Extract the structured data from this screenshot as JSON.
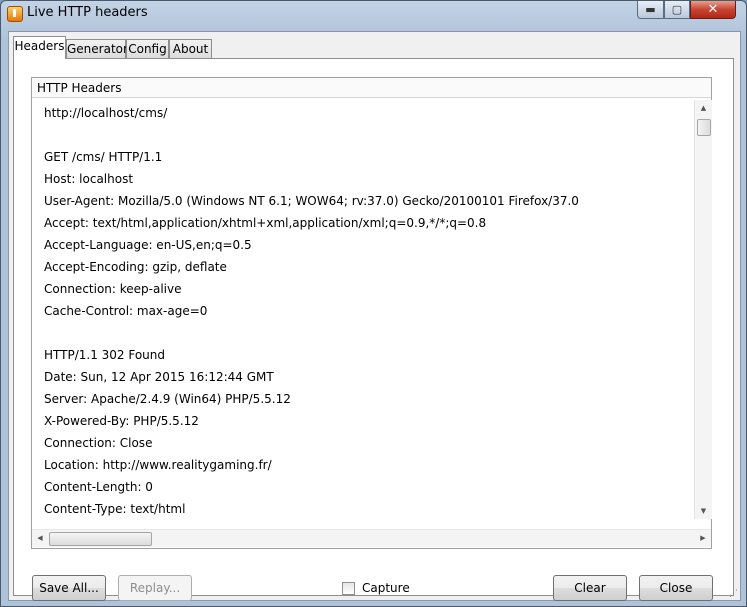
{
  "window": {
    "title": "Live HTTP headers"
  },
  "title_buttons": {
    "minimize": "▬",
    "maximize": "▢",
    "close": "✕"
  },
  "tabs": [
    {
      "label": "Headers",
      "active": true
    },
    {
      "label": "Generator",
      "active": false
    },
    {
      "label": "Config",
      "active": false
    },
    {
      "label": "About",
      "active": false
    }
  ],
  "panel": {
    "group_title": "HTTP Headers",
    "lines": [
      "http://localhost/cms/",
      "",
      "GET /cms/ HTTP/1.1",
      "Host: localhost",
      "User-Agent: Mozilla/5.0 (Windows NT 6.1; WOW64; rv:37.0) Gecko/20100101 Firefox/37.0",
      "Accept: text/html,application/xhtml+xml,application/xml;q=0.9,*/*;q=0.8",
      "Accept-Language: en-US,en;q=0.5",
      "Accept-Encoding: gzip, deflate",
      "Connection: keep-alive",
      "Cache-Control: max-age=0",
      "",
      "HTTP/1.1 302 Found",
      "Date: Sun, 12 Apr 2015 16:12:44 GMT",
      "Server: Apache/2.4.9 (Win64) PHP/5.5.12",
      "X-Powered-By: PHP/5.5.12",
      "Connection: Close",
      "Location: http://www.realitygaming.fr/",
      "Content-Length: 0",
      "Content-Type: text/html"
    ]
  },
  "buttons": {
    "save_all": "Save All...",
    "replay": "Replay...",
    "clear": "Clear",
    "close": "Close"
  },
  "capture": {
    "label": "Capture",
    "checked": false
  }
}
